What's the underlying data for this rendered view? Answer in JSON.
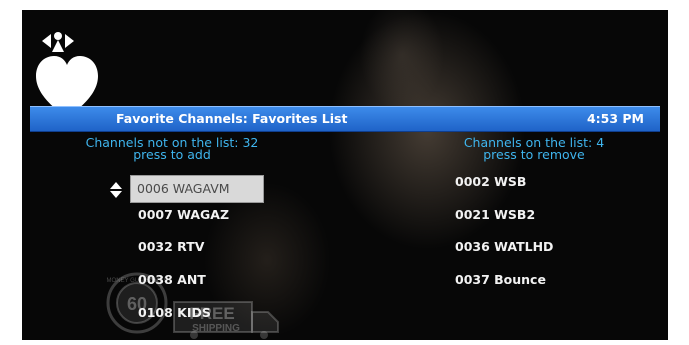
{
  "header": {
    "title": "Favorite Channels: Favorites List",
    "time": "4:53 PM"
  },
  "left_column": {
    "count_label": "Channels not on the list: 32",
    "action_label": "press to add",
    "items": [
      "0006 WAGAVM",
      "0007 WAGAZ",
      "0032 RTV",
      "0038 ANT",
      "0108 KIDS"
    ],
    "selected_index": 0
  },
  "right_column": {
    "count_label": "Channels on the list: 4",
    "action_label": "press to remove",
    "items": [
      "0002 WSB",
      "0021 WSB2",
      "0036 WATLHD",
      "0037 Bounce"
    ]
  },
  "watermark": {
    "badge_number": "60",
    "badge_text": "MONEY GUARANTEE",
    "truck_line1": "FREE",
    "truck_line2": "SHIPPING"
  },
  "icons": [
    "navigation-arrows-icon",
    "heart-icon",
    "up-down-arrows-icon"
  ],
  "colors": {
    "title_bar": "#2a74d8",
    "column_heading": "#3fb5ee",
    "selected_row": "#d9d9d9",
    "background": "#070707"
  }
}
